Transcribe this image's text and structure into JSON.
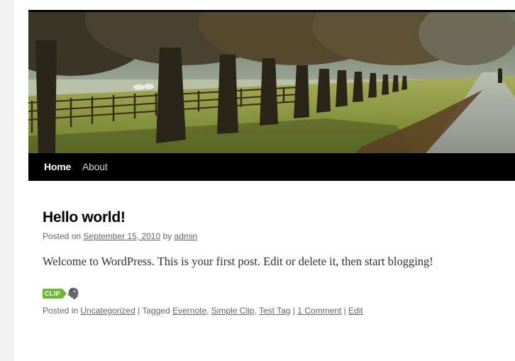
{
  "header": {
    "image_icon": "tree-lined-path-photo"
  },
  "nav": {
    "items": [
      {
        "label": "Home",
        "active": true
      },
      {
        "label": "About",
        "active": false
      }
    ]
  },
  "post": {
    "title": "Hello world!",
    "meta": {
      "posted_on_prefix": "Posted on",
      "date": "September 15, 2010",
      "by_word": "by",
      "author": "admin"
    },
    "content": "Welcome to WordPress. This is your first post. Edit or delete it, then start blogging!",
    "clip_badge": {
      "label": "CLIP",
      "color": "#6fb536",
      "icon": "evernote-elephant-icon"
    },
    "utility": {
      "posted_in_prefix": "Posted in",
      "category": "Uncategorized",
      "sep1": "|",
      "tagged_prefix": "Tagged",
      "tags": [
        "Evernote",
        "Simple Clip",
        "Test Tag"
      ],
      "sep2": "|",
      "comments": "1 Comment",
      "sep3": "|",
      "edit": "Edit"
    }
  }
}
